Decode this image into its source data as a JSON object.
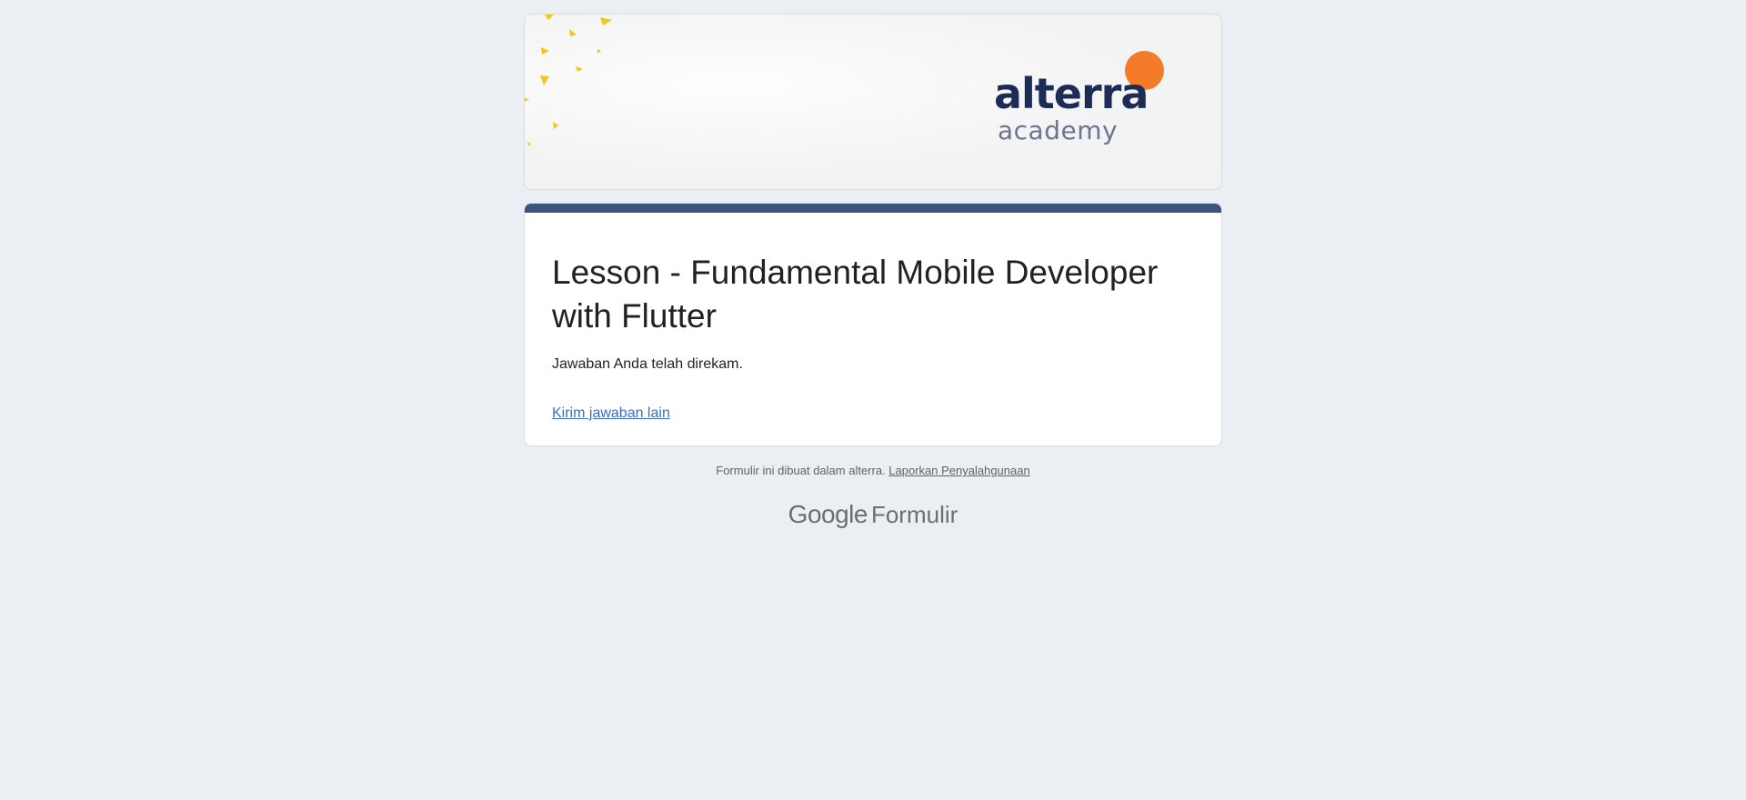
{
  "header": {
    "logo": {
      "wordmark": "alterra",
      "subtitle": "academy",
      "dot_color": "#f47b29",
      "word_color": "#1c2c55"
    },
    "confetti_color": "#f5c518"
  },
  "form": {
    "accent_color": "#3c5580",
    "title": "Lesson - Fundamental Mobile Developer with Flutter",
    "confirmation": "Jawaban Anda telah direkam.",
    "another_response_link": "Kirim jawaban lain"
  },
  "footer": {
    "note": "Formulir ini dibuat dalam alterra.",
    "report_link": "Laporkan Penyalahgunaan",
    "brand_google": "Google",
    "brand_product": "Formulir"
  }
}
